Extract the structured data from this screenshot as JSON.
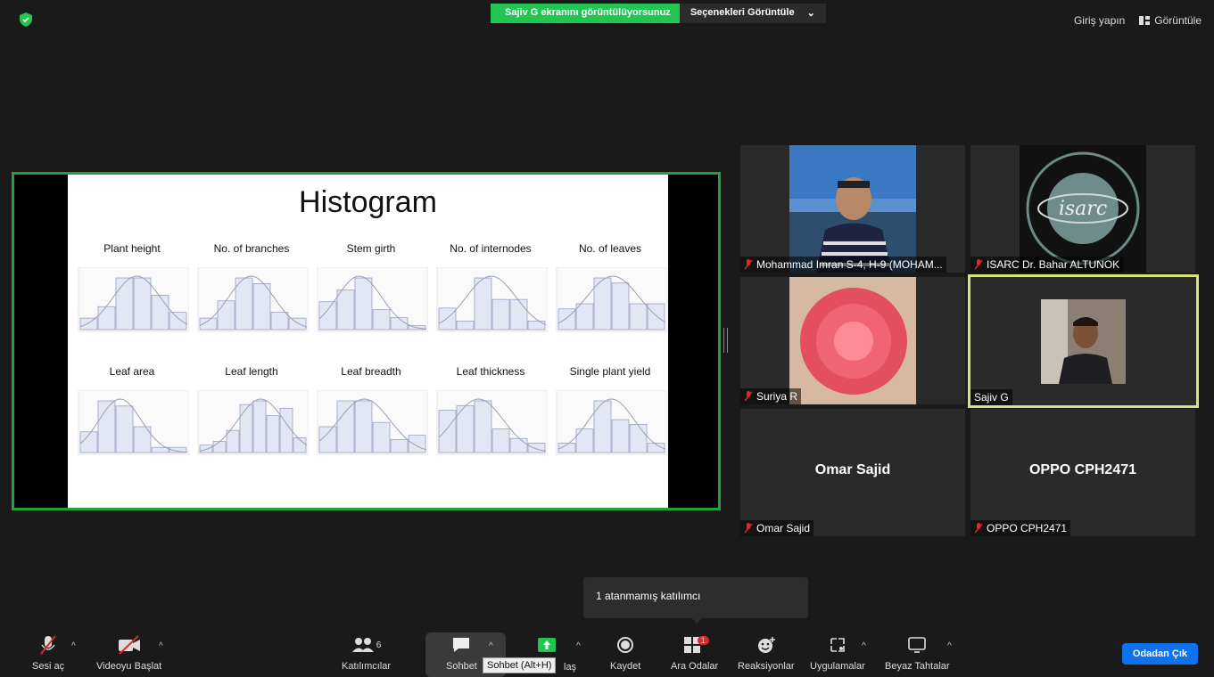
{
  "top_bar": {
    "share_banner": "Sajiv G ekranını görüntülüyorsunuz",
    "view_options": "Seçenekleri Görüntüle",
    "sign_in": "Giriş yapın",
    "view": "Görüntüle"
  },
  "slide": {
    "title": "Histogram",
    "charts": [
      {
        "title": "Plant height",
        "values": [
          2,
          4,
          9,
          9,
          6,
          3
        ]
      },
      {
        "title": "No. of branches",
        "values": [
          2,
          5,
          9,
          8,
          3,
          2
        ]
      },
      {
        "title": "Stem girth",
        "values": [
          7,
          10,
          13,
          5,
          3,
          1
        ]
      },
      {
        "title": "No. of internodes",
        "values": [
          5,
          2,
          12,
          7,
          7,
          2
        ]
      },
      {
        "title": "No. of leaves",
        "values": [
          4,
          5,
          10,
          9,
          5,
          5
        ]
      },
      {
        "title": "Leaf area",
        "values": [
          4,
          10,
          9,
          5,
          1,
          1
        ]
      },
      {
        "title": "Leaf length",
        "values": [
          2,
          3,
          6,
          13,
          14,
          10,
          12,
          4
        ]
      },
      {
        "title": "Leaf breadth",
        "values": [
          6,
          12,
          12,
          7,
          3,
          4
        ]
      },
      {
        "title": "Leaf thickness",
        "values": [
          9,
          10,
          11,
          5,
          3,
          2
        ]
      },
      {
        "title": "Single plant yield",
        "values": [
          2,
          5,
          11,
          7,
          6,
          2
        ]
      }
    ]
  },
  "participants": [
    {
      "name": "Mohammad Imran S-4, H-9 (MOHAM...",
      "type": "photo-man-seaside",
      "muted": true
    },
    {
      "name": "ISARC Dr. Bahar ALTUNOK",
      "type": "logo-isarc",
      "logo_text": "isarc",
      "muted": true
    },
    {
      "name": "Suriya R",
      "type": "photo-red-flower",
      "muted": true
    },
    {
      "name": "Sajiv G",
      "type": "photo-man-car",
      "muted": false,
      "active_speaker": true
    },
    {
      "name": "Omar Sajid",
      "display": "Omar Sajid",
      "muted": true
    },
    {
      "name": "OPPO CPH2471",
      "display": "OPPO CPH2471",
      "muted": true
    }
  ],
  "popup": {
    "text": "1 atanmamış katılımcı"
  },
  "toolbar": {
    "unmute": "Sesi aç",
    "start_video": "Videoyu Başlat",
    "participants": "Katılımcılar",
    "participants_count": "6",
    "chat": "Sohbet",
    "chat_tooltip": "Sohbet (Alt+H)",
    "share_partial": "laş",
    "record": "Kaydet",
    "breakout": "Ara Odalar",
    "breakout_badge": "1",
    "reactions": "Reaksiyonlar",
    "apps": "Uygulamalar",
    "whiteboard": "Beyaz Tahtalar",
    "leave": "Odadan Çık"
  },
  "colors": {
    "share_green": "#23c552",
    "active_border": "#d7e27a",
    "screen_border": "#1fa23a",
    "leave_blue": "#0e72ed"
  }
}
